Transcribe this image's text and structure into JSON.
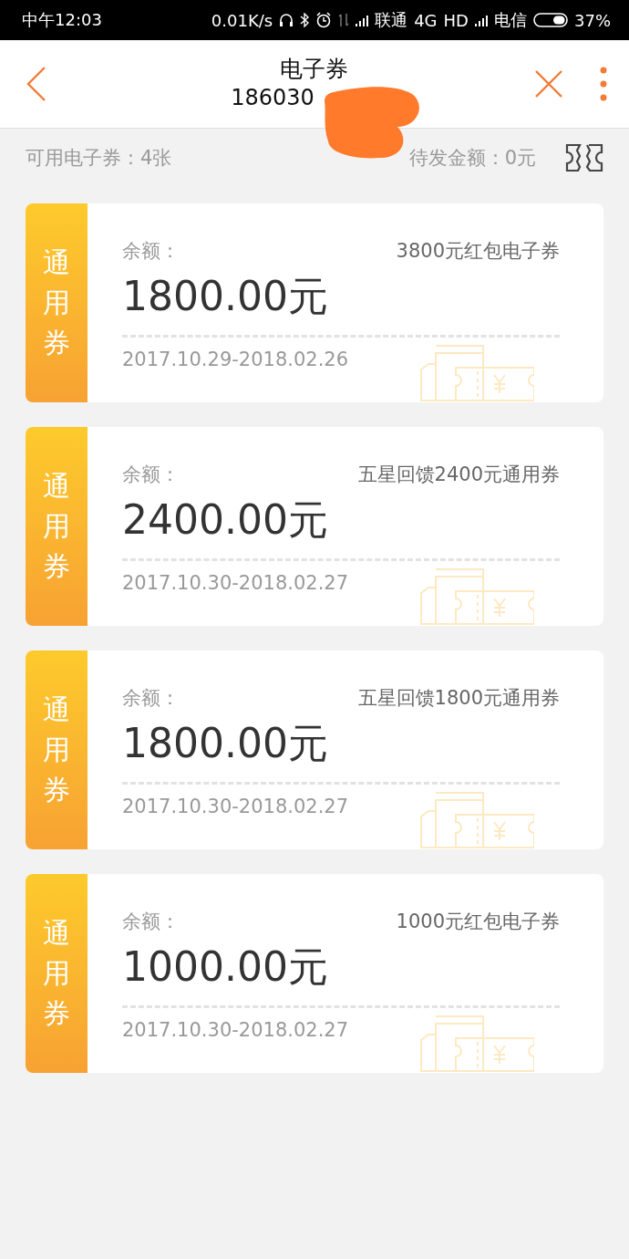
{
  "status_bar": {
    "time": "中午12:03",
    "speed": "0.01K/s",
    "carrier_1": "联通",
    "network": "4G",
    "hd": "HD",
    "carrier_2": "电信",
    "battery": "37%"
  },
  "header": {
    "title": "电子券",
    "subtitle": "186030"
  },
  "summary": {
    "available": "可用电子券：4张",
    "pending": "待发金额：0元"
  },
  "coupons": [
    {
      "tag": "通用券",
      "balance_label": "余额：",
      "name": "3800元红包电子券",
      "amount": "1800.00元",
      "validity": "2017.10.29-2018.02.26"
    },
    {
      "tag": "通用券",
      "balance_label": "余额：",
      "name": "五星回馈2400元通用券",
      "amount": "2400.00元",
      "validity": "2017.10.30-2018.02.27"
    },
    {
      "tag": "通用券",
      "balance_label": "余额：",
      "name": "五星回馈1800元通用券",
      "amount": "1800.00元",
      "validity": "2017.10.30-2018.02.27"
    },
    {
      "tag": "通用券",
      "balance_label": "余额：",
      "name": "1000元红包电子券",
      "amount": "1000.00元",
      "validity": "2017.10.30-2018.02.27"
    }
  ]
}
